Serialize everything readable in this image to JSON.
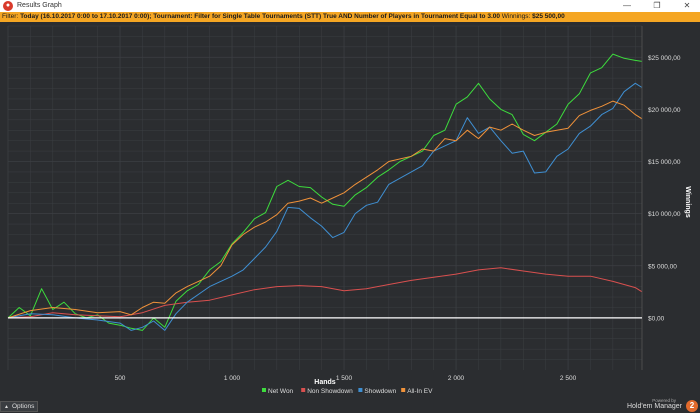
{
  "window": {
    "title": "Results Graph",
    "minimize_glyph": "—",
    "restore_glyph": "❐",
    "close_glyph": "✕"
  },
  "filter": {
    "label": "Filter:",
    "text": "Today (16.10.2017 0:00 to 17.10.2017 0:00); Tournament: Filter for Single Table Tournaments (STT) True AND Number of Players in Tournament Equal to 3.00",
    "winnings_label": "Winnings:",
    "winnings_value": "$25 500,00"
  },
  "bottom": {
    "options_label": "Options",
    "powered_by": "Powered by",
    "brand": "Hold'em Manager",
    "brand_badge": "2"
  },
  "colors": {
    "net_won": "#3ddc3d",
    "non_showdown": "#d9504f",
    "showdown": "#3f8fd2",
    "all_in_ev": "#f0923a",
    "zero_line": "#ffffff",
    "grid": "#3c3f43",
    "background": "#2b2d30"
  },
  "chart_data": {
    "type": "line",
    "xlabel": "Hands",
    "ylabel": "Winnings",
    "xlim": [
      0,
      2830
    ],
    "ylim": [
      -5000,
      28000
    ],
    "x_ticks": [
      {
        "value": 500,
        "label": "500"
      },
      {
        "value": 1000,
        "label": "1 000"
      },
      {
        "value": 1500,
        "label": "1 500"
      },
      {
        "value": 2000,
        "label": "2 000"
      },
      {
        "value": 2500,
        "label": "2 500"
      }
    ],
    "y_ticks": [
      {
        "value": 0,
        "label": "$0,00"
      },
      {
        "value": 5000,
        "label": "$5 000,00"
      },
      {
        "value": 10000,
        "label": "$10 000,00"
      },
      {
        "value": 15000,
        "label": "$15 000,00"
      },
      {
        "value": 20000,
        "label": "$20 000,00"
      },
      {
        "value": 25000,
        "label": "$25 000,00"
      }
    ],
    "grid": true,
    "legend_position": "bottom-center",
    "series": [
      {
        "name": "Net Won",
        "color_key": "net_won",
        "x": [
          0,
          50,
          100,
          150,
          200,
          250,
          300,
          350,
          400,
          450,
          500,
          550,
          600,
          650,
          700,
          750,
          800,
          850,
          900,
          950,
          1000,
          1050,
          1100,
          1150,
          1200,
          1250,
          1300,
          1350,
          1400,
          1450,
          1500,
          1550,
          1600,
          1650,
          1700,
          1750,
          1800,
          1850,
          1900,
          1950,
          2000,
          2050,
          2100,
          2150,
          2200,
          2250,
          2300,
          2350,
          2400,
          2450,
          2500,
          2550,
          2600,
          2650,
          2700,
          2750,
          2800,
          2830
        ],
        "y": [
          0,
          1000,
          200,
          2800,
          800,
          1500,
          400,
          0,
          300,
          -500,
          -700,
          -1000,
          -1200,
          0,
          -900,
          1600,
          2600,
          3200,
          4600,
          5400,
          7100,
          8200,
          9500,
          10100,
          12600,
          13200,
          12600,
          12500,
          11600,
          10900,
          10700,
          11800,
          12500,
          13500,
          14200,
          15000,
          15500,
          16000,
          17500,
          18000,
          20500,
          21200,
          22500,
          21000,
          20000,
          19500,
          17600,
          17000,
          17800,
          18600,
          20500,
          21500,
          23500,
          24000,
          25300,
          24900,
          24700,
          24600
        ]
      },
      {
        "name": "Non Showdown",
        "color_key": "non_showdown",
        "x": [
          0,
          100,
          200,
          300,
          400,
          500,
          600,
          700,
          800,
          900,
          1000,
          1100,
          1200,
          1300,
          1400,
          1500,
          1600,
          1700,
          1800,
          1900,
          2000,
          2100,
          2200,
          2300,
          2400,
          2500,
          2600,
          2700,
          2800,
          2830
        ],
        "y": [
          0,
          100,
          500,
          300,
          200,
          100,
          500,
          1200,
          1500,
          1700,
          2200,
          2700,
          3000,
          3100,
          3000,
          2600,
          2800,
          3200,
          3600,
          3900,
          4200,
          4600,
          4800,
          4500,
          4200,
          4000,
          4000,
          3500,
          2900,
          2500
        ]
      },
      {
        "name": "Showdown",
        "color_key": "showdown",
        "x": [
          0,
          100,
          200,
          300,
          400,
          500,
          550,
          600,
          650,
          700,
          750,
          800,
          900,
          1000,
          1050,
          1100,
          1150,
          1200,
          1250,
          1300,
          1350,
          1400,
          1450,
          1500,
          1550,
          1600,
          1650,
          1700,
          1800,
          1850,
          1900,
          2000,
          2050,
          2100,
          2150,
          2200,
          2250,
          2300,
          2350,
          2400,
          2450,
          2500,
          2550,
          2600,
          2650,
          2700,
          2750,
          2800,
          2830
        ],
        "y": [
          0,
          400,
          300,
          0,
          -200,
          -500,
          -1200,
          -900,
          -300,
          -1200,
          400,
          1500,
          3000,
          4000,
          4600,
          5700,
          6800,
          8300,
          10600,
          10500,
          9600,
          8800,
          7700,
          8200,
          10000,
          10800,
          11100,
          12800,
          14000,
          14600,
          16000,
          17000,
          19200,
          17700,
          18300,
          17000,
          15800,
          16000,
          13900,
          14000,
          15500,
          16200,
          17700,
          18400,
          19500,
          20100,
          21700,
          22500,
          22100
        ]
      },
      {
        "name": "All-In EV",
        "color_key": "all_in_ev",
        "x": [
          0,
          100,
          200,
          300,
          400,
          500,
          550,
          600,
          650,
          700,
          750,
          800,
          850,
          900,
          950,
          1000,
          1050,
          1100,
          1150,
          1200,
          1250,
          1300,
          1350,
          1400,
          1450,
          1500,
          1550,
          1600,
          1650,
          1700,
          1800,
          1850,
          1900,
          1950,
          2000,
          2050,
          2100,
          2150,
          2200,
          2250,
          2300,
          2350,
          2400,
          2450,
          2500,
          2550,
          2600,
          2650,
          2700,
          2750,
          2800,
          2830
        ],
        "y": [
          0,
          700,
          1000,
          800,
          500,
          600,
          300,
          1000,
          1500,
          1400,
          2400,
          3000,
          3500,
          4000,
          5000,
          7000,
          8000,
          8700,
          9200,
          9900,
          11000,
          11200,
          11500,
          11000,
          11500,
          12000,
          12800,
          13500,
          14200,
          15000,
          15500,
          16200,
          16000,
          17200,
          17000,
          18000,
          17200,
          18300,
          18000,
          18600,
          18000,
          17500,
          17800,
          18000,
          18200,
          19400,
          19900,
          20300,
          20800,
          20400,
          19500,
          19100
        ]
      }
    ]
  }
}
